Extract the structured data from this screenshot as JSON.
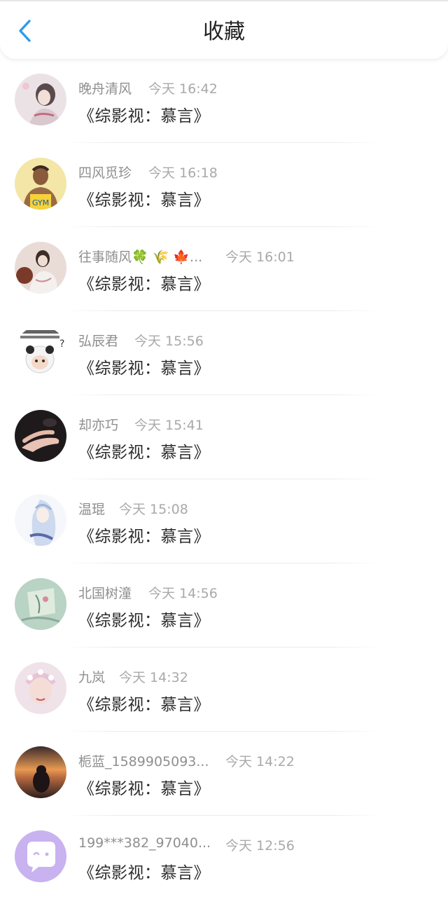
{
  "header": {
    "title": "收藏",
    "back_icon": "chevron-left-icon",
    "accent": "#2d9bea"
  },
  "items": [
    {
      "username": "晚舟清风",
      "time": "今天 16:42",
      "content": "《综影视：慕言》"
    },
    {
      "username": "四风觅珍",
      "time": "今天 16:18",
      "content": "《综影视：慕言》"
    },
    {
      "username": "往事随风🍀 🌾 🍁...",
      "time": "今天 16:01",
      "content": "《综影视：慕言》"
    },
    {
      "username": "弘辰君",
      "time": "今天 15:56",
      "content": "《综影视：慕言》"
    },
    {
      "username": "却亦巧",
      "time": "今天 15:41",
      "content": "《综影视：慕言》"
    },
    {
      "username": "温琨",
      "time": "今天 15:08",
      "content": "《综影视：慕言》"
    },
    {
      "username": "北国树潼",
      "time": "今天 14:56",
      "content": "《综影视：慕言》"
    },
    {
      "username": "九岚",
      "time": "今天 14:32",
      "content": "《综影视：慕言》"
    },
    {
      "username": "栀蓝_1589905093...",
      "time": "今天 14:22",
      "content": "《综影视：慕言》"
    },
    {
      "username": "199***382_97040...",
      "time": "今天 12:56",
      "content": "《综影视：慕言》"
    }
  ]
}
